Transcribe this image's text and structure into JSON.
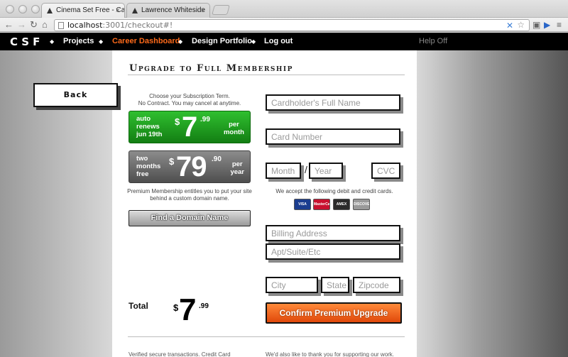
{
  "browser": {
    "tabs": [
      {
        "label": "Cinema Set Free - Career I"
      },
      {
        "label": "Lawrence Whiteside"
      }
    ],
    "url_host": "localhost",
    "url_rest": ":3001/checkout#!"
  },
  "sitenav": {
    "logo": "CSF",
    "items": [
      {
        "label": "Projects"
      },
      {
        "label": "Career Dashboard"
      },
      {
        "label": "Design Portfolio"
      },
      {
        "label": "Log out"
      }
    ],
    "help": "Help Off",
    "active_color": "#ff6a1a"
  },
  "back_button": "Back",
  "heading": "Upgrade to Full Membership",
  "subscription": {
    "intro_line1": "Choose your Subscription Term.",
    "intro_line2": "No Contract. You may cancel at anytime.",
    "plans": [
      {
        "note_line1": "auto",
        "note_line2": "renews",
        "note_line3": "jun 19th",
        "dollar": "$",
        "amount": "7",
        "cents": ".99",
        "per1": "per",
        "per2": "month",
        "color": "#1f9e1f"
      },
      {
        "note_line1": "two",
        "note_line2": "months",
        "note_line3": "free",
        "dollar": "$",
        "amount": "79",
        "cents": ".90",
        "per1": "per",
        "per2": "year",
        "color": "#6b6b6b"
      }
    ],
    "premium_line1": "Premium Membership entitles you to put your site",
    "premium_line2": "behind a custom domain name.",
    "domain_button": "Find a Domain Name"
  },
  "payment": {
    "cardholder_placeholder": "Cardholder's Full Name",
    "card_number_placeholder": "Card Number",
    "month_placeholder": "Month",
    "slash": "/",
    "year_placeholder": "Year",
    "cvc_placeholder": "CVC",
    "cards_note": "We accept the following debit and credit cards.",
    "cards": [
      {
        "name": "VISA",
        "color": "#1a3d8f"
      },
      {
        "name": "MasterCard",
        "color": "#c8102e"
      },
      {
        "name": "AMEX",
        "color": "#2b2b2b"
      },
      {
        "name": "DISCOVER",
        "color": "#9a9a9a"
      }
    ],
    "billing_address_placeholder": "Billing Address",
    "apt_placeholder": "Apt/Suite/Etc",
    "city_placeholder": "City",
    "state_placeholder": "State",
    "zip_placeholder": "Zipcode"
  },
  "total": {
    "label": "Total",
    "dollar": "$",
    "amount": "7",
    "cents": ".99"
  },
  "confirm_button": "Confirm Premium Upgrade",
  "footer": {
    "left": "Verified secure transactions. Credit Card",
    "right": "We'd also like to thank you for supporting our work."
  }
}
